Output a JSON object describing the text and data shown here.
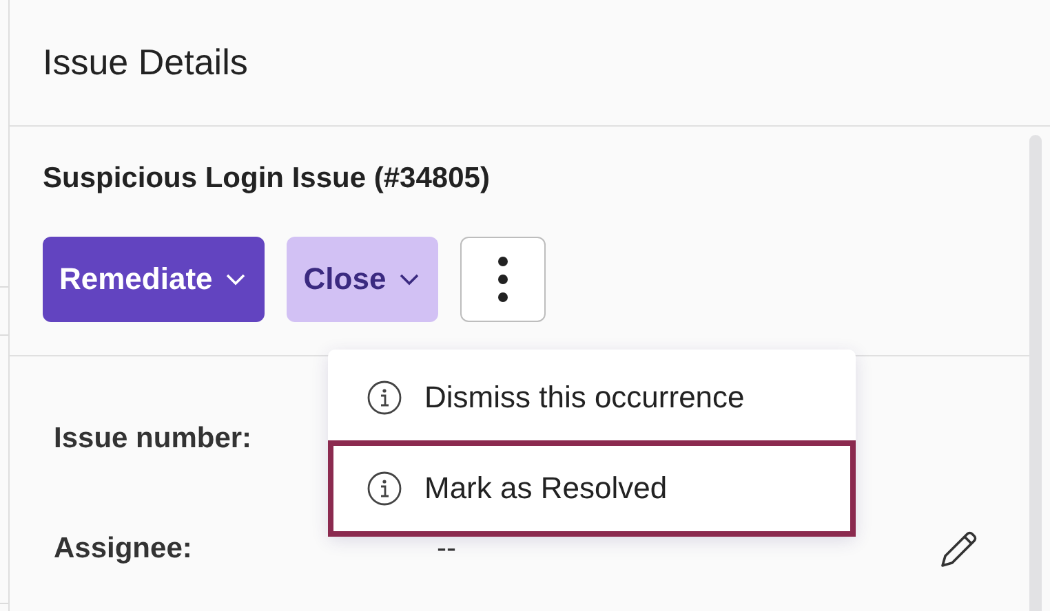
{
  "panel": {
    "title": "Issue Details"
  },
  "issue": {
    "title": "Suspicious Login Issue (#34805)"
  },
  "actions": [
    {
      "kind": "primary",
      "label": "Remediate"
    },
    {
      "kind": "secondary",
      "label": "Close"
    },
    {
      "kind": "more"
    }
  ],
  "menu": {
    "items": [
      {
        "label": "Dismiss this occurrence",
        "selected": false
      },
      {
        "label": "Mark as Resolved",
        "selected": true
      }
    ]
  },
  "fields": [
    {
      "label": "Issue number:"
    },
    {
      "label": "Assignee:",
      "value": "--",
      "editable": true
    }
  ]
}
